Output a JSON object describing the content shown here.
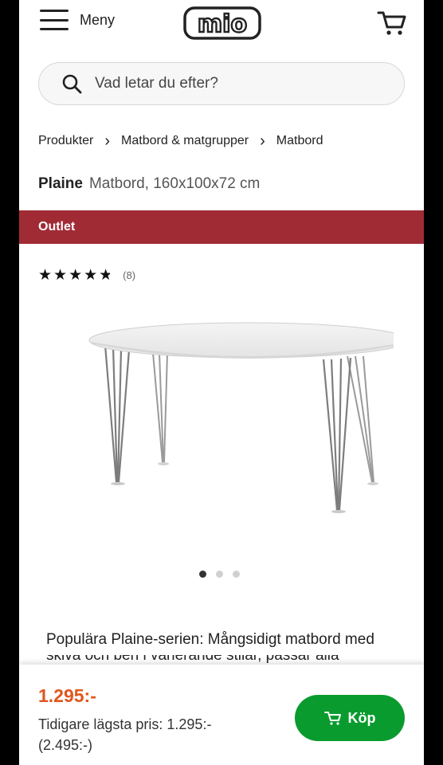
{
  "header": {
    "menu_label": "Meny",
    "logo_text": "mio"
  },
  "search": {
    "placeholder": "Vad letar du efter?"
  },
  "breadcrumb": {
    "items": [
      "Produkter",
      "Matbord & matgrupper",
      "Matbord"
    ]
  },
  "product": {
    "name": "Plaine",
    "description": "Matbord, 160x100x72 cm",
    "badge": "Outlet",
    "rating": {
      "stars": 4.5,
      "count": "(8)"
    },
    "image_icon": "oval-dining-table-image",
    "carousel": {
      "total": 3,
      "active": 1
    },
    "text_line1": "Populära Plaine-serien: Mångsidigt matbord med",
    "text_line2": "skiva och ben i varierande stilar, passar alla"
  },
  "purchase": {
    "price": "1.295:-",
    "previous_price": "Tidigare lägsta pris: 1.295:- (2.495:-)",
    "buy_label": "Köp"
  },
  "colors": {
    "outlet_banner": "#a12b35",
    "price": "#e0561f",
    "buy_button": "#0a9b2f"
  }
}
